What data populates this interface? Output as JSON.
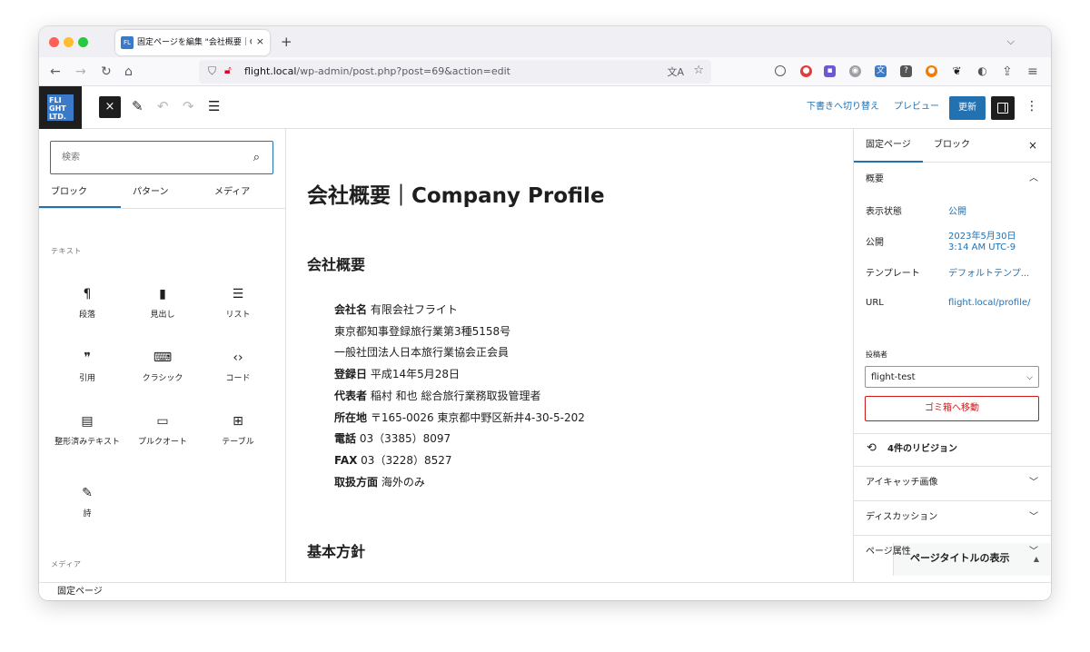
{
  "browser": {
    "tab_title": "固定ページを編集 \"会社概要｜Co",
    "tab_close": "×",
    "new_tab": "+",
    "tab_list": "⌵",
    "url_host": "flight.local",
    "url_path": "/wp-admin/post.php?post=69&action=edit"
  },
  "toolbar": {
    "logo_text": "FLI GHT LTD.",
    "close": "×",
    "switch_draft": "下書きへ切り替え",
    "preview": "プレビュー",
    "update": "更新",
    "more": "⋮"
  },
  "inserter": {
    "search_placeholder": "検索",
    "tabs": [
      "ブロック",
      "パターン",
      "メディア"
    ],
    "category_text": "テキスト",
    "category_media": "メディア",
    "blocks": [
      {
        "label": "段落",
        "icon": "¶",
        "icon_name": "paragraph-icon"
      },
      {
        "label": "見出し",
        "icon": "▮",
        "icon_name": "bookmark-icon"
      },
      {
        "label": "リスト",
        "icon": "☰",
        "icon_name": "list-icon"
      },
      {
        "label": "引用",
        "icon": "❞",
        "icon_name": "quote-icon"
      },
      {
        "label": "クラシック",
        "icon": "⌨",
        "icon_name": "keyboard-icon"
      },
      {
        "label": "コード",
        "icon": "‹›",
        "icon_name": "code-icon"
      },
      {
        "label": "整形済みテキスト",
        "icon": "▤",
        "icon_name": "preformatted-icon"
      },
      {
        "label": "プルクオート",
        "icon": "▭",
        "icon_name": "pullquote-icon"
      },
      {
        "label": "テーブル",
        "icon": "⊞",
        "icon_name": "table-icon"
      },
      {
        "label": "詩",
        "icon": "✎",
        "icon_name": "verse-icon"
      }
    ],
    "media_icons": [
      "▭",
      "▭",
      "♪"
    ]
  },
  "content": {
    "title": "会社概要｜Company Profile",
    "heading1": "会社概要",
    "lines": [
      {
        "label": "会社名",
        "value": " 有限会社フライト"
      },
      {
        "label": "",
        "value": "東京都知事登録旅行業第3種5158号"
      },
      {
        "label": "",
        "value": "一般社団法人日本旅行業協会正会員"
      },
      {
        "label": "登録日",
        "value": " 平成14年5月28日"
      },
      {
        "label": "代表者",
        "value": " 稲村 和也 総合旅行業務取扱管理者"
      },
      {
        "label": "所在地",
        "value": " 〒165-0026 東京都中野区新井4-30-5-202"
      },
      {
        "label": "電話",
        "value": " 03（3385）8097"
      },
      {
        "label": "FAX",
        "value": " 03（3228）8527"
      },
      {
        "label": "取扱方面",
        "value": " 海外のみ"
      }
    ],
    "heading2": "基本方針"
  },
  "sidebar": {
    "tabs": [
      "固定ページ",
      "ブロック"
    ],
    "close": "×",
    "summary_title": "概要",
    "rows": [
      {
        "label": "表示状態",
        "value": "公開"
      },
      {
        "label": "公開",
        "value": "2023年5月30日",
        "value2": "3:14 AM UTC-9"
      },
      {
        "label": "テンプレート",
        "value": "デフォルトテンプ..."
      },
      {
        "label": "URL",
        "value": "flight.local/profile/"
      }
    ],
    "author_label": "投稿者",
    "author_value": "flight-test",
    "trash": "ゴミ箱へ移動",
    "revisions": "4件のリビジョン",
    "panels": [
      "アイキャッチ画像",
      "ディスカッション",
      "ページ属性"
    ],
    "meta_box_title": "ページタイトルの表示"
  },
  "footer": {
    "breadcrumb": "固定ページ"
  }
}
